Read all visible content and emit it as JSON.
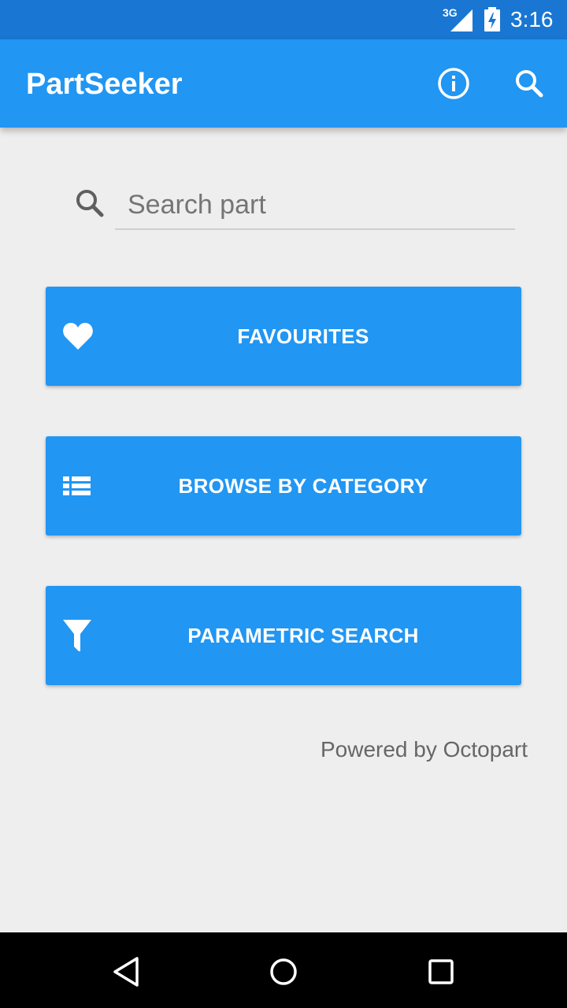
{
  "status_bar": {
    "network": "3G",
    "time": "3:16"
  },
  "app_bar": {
    "title": "PartSeeker",
    "actions": [
      "info-icon",
      "search-icon"
    ]
  },
  "search": {
    "placeholder": "Search part",
    "value": ""
  },
  "menu_buttons": [
    {
      "label": "FAVOURITES",
      "icon": "heart-icon"
    },
    {
      "label": "BROWSE BY CATEGORY",
      "icon": "list-icon"
    },
    {
      "label": "PARAMETRIC SEARCH",
      "icon": "filter-icon"
    }
  ],
  "footer": {
    "powered_by": "Powered by Octopart"
  },
  "nav_bar": {
    "buttons": [
      "back-icon",
      "home-icon",
      "recents-icon"
    ]
  },
  "colors": {
    "status_bar": "#1976d2",
    "primary": "#2196f3",
    "background": "#eeeeee",
    "nav_bar": "#000000"
  }
}
